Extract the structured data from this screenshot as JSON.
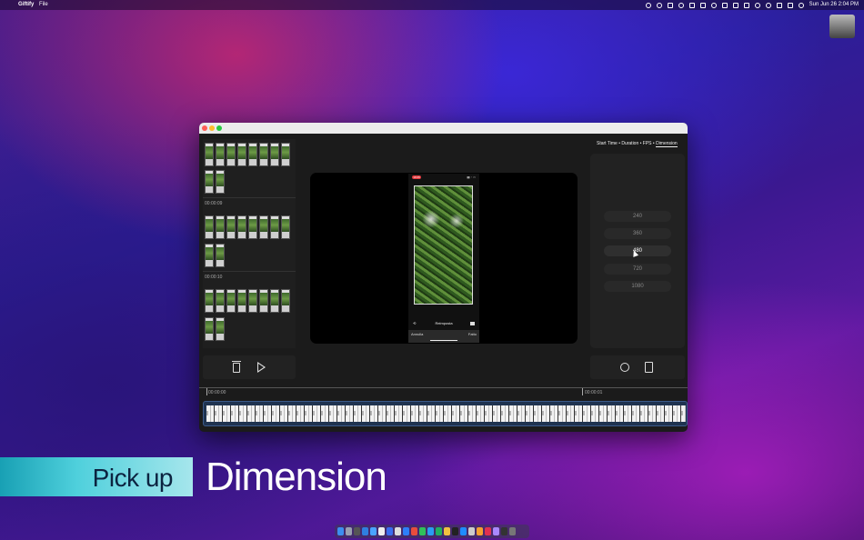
{
  "menubar": {
    "app_name": "Giftify",
    "menu_file": "File",
    "clock": "Sun Jun 26  2:04 PM"
  },
  "sidebar": {
    "time_labels": [
      "00:00:09",
      "00:00:10"
    ]
  },
  "phone_preview": {
    "rec_badge": "10:26",
    "center_label": "Reimposta",
    "cancel_label": "Annulla",
    "done_label": "Fatto"
  },
  "breadcrumb": {
    "items": [
      "Start Time",
      "Duration",
      "FPS",
      "Dimension"
    ],
    "separator": "•",
    "active": "Dimension"
  },
  "dimensions": {
    "options": [
      "240",
      "360",
      "480",
      "720",
      "1080"
    ],
    "selected": "480"
  },
  "timeline": {
    "start_label": "00:00:00",
    "end_label": "00:00:01"
  },
  "caption": {
    "pill_text": "Pick up",
    "main_text": "Dimension"
  }
}
